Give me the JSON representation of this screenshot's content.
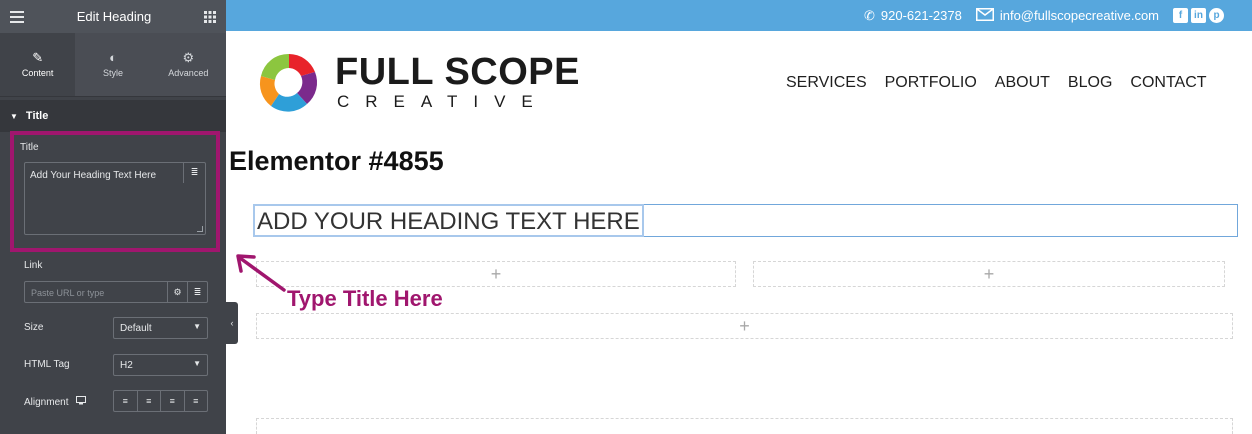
{
  "editor": {
    "header_title": "Edit Heading",
    "tabs": [
      {
        "label": "Content",
        "icon": "pencil-icon",
        "active": true
      },
      {
        "label": "Style",
        "icon": "contrast-icon",
        "active": false
      },
      {
        "label": "Advanced",
        "icon": "gear-icon",
        "active": false
      }
    ],
    "section_title": "Title",
    "title_field": {
      "label": "Title",
      "value": "Add Your Heading Text Here"
    },
    "link_field": {
      "label": "Link",
      "placeholder": "Paste URL or type"
    },
    "size_field": {
      "label": "Size",
      "value": "Default"
    },
    "html_tag_field": {
      "label": "HTML Tag",
      "value": "H2"
    },
    "alignment_field": {
      "label": "Alignment"
    }
  },
  "site": {
    "phone": "920-621-2378",
    "email": "info@fullscopecreative.com",
    "logo_line1": "FULL SCOPE",
    "logo_line2": "CREATIVE",
    "nav": [
      "SERVICES",
      "PORTFOLIO",
      "ABOUT",
      "BLOG",
      "CONTACT"
    ],
    "page_title": "Elementor #4855",
    "heading_text": "ADD YOUR HEADING TEXT HERE",
    "add_glyph": "+"
  },
  "annotation": {
    "callout": "Type Title Here",
    "color": "#a0166e"
  },
  "colors": {
    "panel_bg": "#404349",
    "topbar": "#57a7dd",
    "highlight": "#a0166e"
  }
}
